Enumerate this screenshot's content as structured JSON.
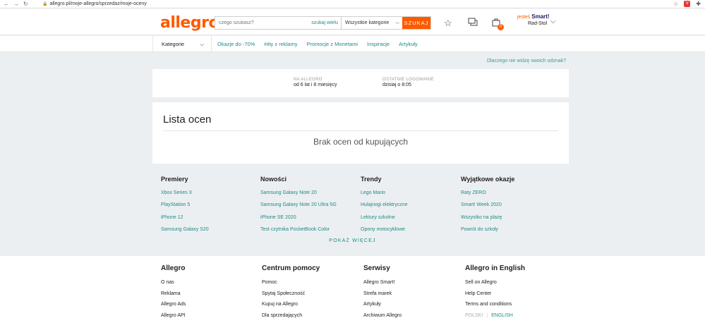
{
  "browser": {
    "back_glyph": "←",
    "forward_glyph": "→",
    "reload_glyph": "↻",
    "url": "allegro.pl/moje-allegro/sprzedaz/moje-oceny",
    "ext_badge": "V"
  },
  "header": {
    "logo": "allegro",
    "search_placeholder": "czego szukasz?",
    "search_multi": "szukaj wielu",
    "category_select": "Wszystkie kategorie",
    "search_button": "SZUKAJ",
    "cart_count": "0",
    "user_prefix": "jesteś",
    "user_smart": "Smart!",
    "user_name": "Rad-Stol"
  },
  "nav": {
    "categories_label": "Kategorie",
    "links": [
      "Okazje do -70%",
      "Hity z reklamy",
      "Promocje z Monetami",
      "Inspiracje",
      "Artykuły"
    ]
  },
  "badge_link": "Dlaczego nie widzę swoich odznak?",
  "profile": {
    "on_allegro_label": "NA ALLEGRO",
    "on_allegro_value": "od 6 lat i 8 miesięcy",
    "last_login_label": "OSTATNIE LOGOWANIE",
    "last_login_value": "dzisiaj o 8:05"
  },
  "ratings": {
    "title": "Lista ocen",
    "empty_message": "Brak ocen od kupujących"
  },
  "promo": [
    {
      "heading": "Premiery",
      "items": [
        "Xbox Series X",
        "PlayStation 5",
        "iPhone 12",
        "Samsung Galaxy S20"
      ]
    },
    {
      "heading": "Nowości",
      "items": [
        "Samsung Galaxy Note 20",
        "Samsung Galaxy Note 20 Ultra 5G",
        "iPhone SE 2020",
        "Test czytnika PocketBook Color"
      ]
    },
    {
      "heading": "Trendy",
      "items": [
        "Lego Mario",
        "Hulajnogi elektryczne",
        "Lektury szkolne",
        "Opony motocyklowe"
      ]
    },
    {
      "heading": "Wyjątkowe okazje",
      "items": [
        "Raty ZERO",
        "Smart! Week 2020",
        "Wszystko na plażę",
        "Powrót do szkoły"
      ]
    }
  ],
  "show_more": "POKAŻ WIĘCEJ",
  "footer": [
    {
      "heading": "Allegro",
      "items": [
        "O nas",
        "Reklama",
        "Allegro Ads",
        "Allegro API"
      ]
    },
    {
      "heading": "Centrum pomocy",
      "items": [
        "Pomoc",
        "Spytaj Społeczność",
        "Kupuj na Allegro",
        "Dla sprzedających"
      ]
    },
    {
      "heading": "Serwisy",
      "items": [
        "Allegro Smart!",
        "Strefa marek",
        "Artykuły",
        "Archiwum Allegro"
      ]
    },
    {
      "heading": "Allegro in English",
      "items": [
        "Sell on Allegro",
        "Help Center",
        "Terms and conditions"
      ]
    }
  ],
  "language": {
    "pl": "POLSKI",
    "en": "ENGLISH"
  },
  "colors": {
    "brand": "#ff5a00",
    "link": "#1e8c87",
    "background": "#eceff1"
  }
}
